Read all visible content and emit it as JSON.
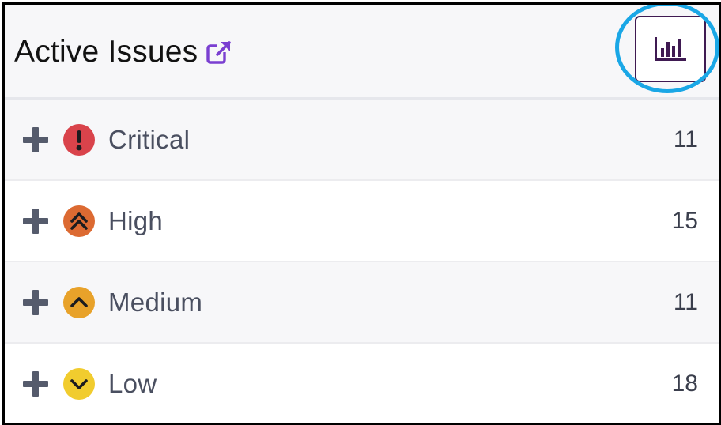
{
  "header": {
    "title": "Active Issues"
  },
  "icons": {
    "external_link": "external-link-icon",
    "chart": "bar-chart-icon",
    "expand": "plus-icon"
  },
  "colors": {
    "accent": "#7a3fd1",
    "chart_button_border": "#3f1a52",
    "highlight_ring": "#1aa7e6",
    "critical": "#d9434b",
    "high": "#dc6a32",
    "medium": "#e8a22a",
    "low": "#f1cc2e"
  },
  "issues": [
    {
      "label": "Critical",
      "count": "11",
      "icon": "exclamation-icon"
    },
    {
      "label": "High",
      "count": "15",
      "icon": "double-chevron-up-icon"
    },
    {
      "label": "Medium",
      "count": "11",
      "icon": "chevron-up-icon"
    },
    {
      "label": "Low",
      "count": "18",
      "icon": "chevron-down-icon"
    }
  ]
}
